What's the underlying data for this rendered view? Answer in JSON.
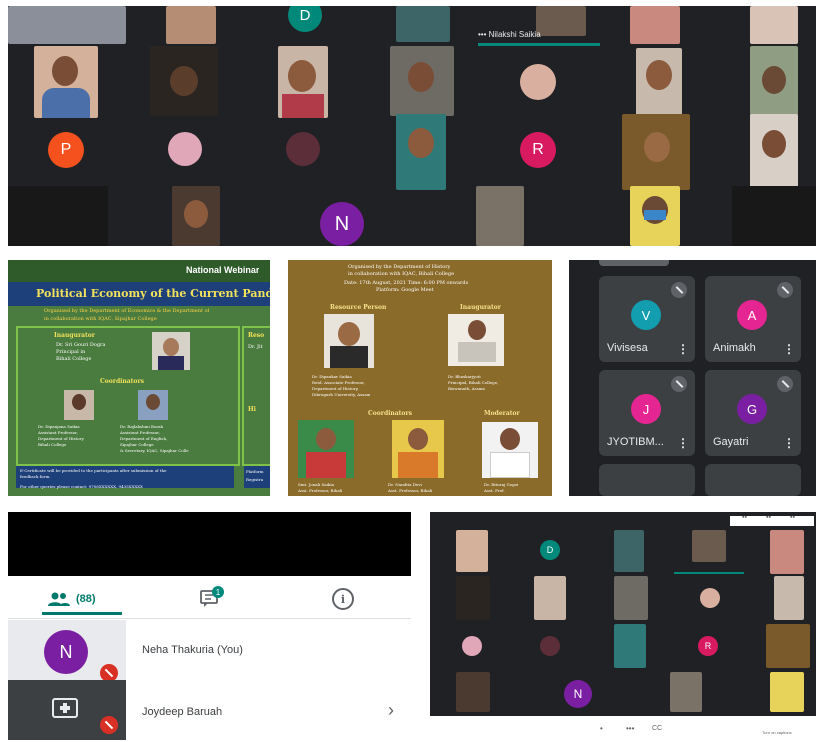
{
  "top_grid": {
    "tile_letters": [
      "D",
      "P",
      "R",
      "N"
    ],
    "name_strip": "••• Nilakshi Saikia"
  },
  "poster1": {
    "banner": "National Webinar",
    "title": "Political Economy of the Current Pandemic: C",
    "subtitle": "Organised by the Department of Economics & the Department of",
    "subtitle2": "in collaboration with IQAC, Sipajhar College",
    "inaugurator_heading": "Inaugurator",
    "inaugurator_name": "Dr. Sri Gouri Dogra",
    "inaugurator_role": "Principal in",
    "inaugurator_org": "Bihali College",
    "coordinators_heading": "Coordinators",
    "coord1_name": "Dr. Dipanjana Saikia",
    "coord1_role": "Assistant Professor,",
    "coord1_dept": "Department of History",
    "coord1_org": "Bihali College",
    "coord2_name": "Dr. Rajlakshmi Borah",
    "coord2_role": "Assistant Professor,",
    "coord2_dept": "Department of English,",
    "coord2_org": "Sipajhar College",
    "coord2_extra": "& Secretary, IQAC, Sipajhar Colle",
    "footer1": "E-Certificate will be provided to the participants after submission of the",
    "footer1b": "feedback form.",
    "footer2": "For other queries please contact: 9706XXXXXX, 9435XXXXX",
    "right_heading": "Reso",
    "right_name": "Dr. Jit",
    "right_label1": "Hi",
    "right_footer": "Platform",
    "right_footer2": "Registra"
  },
  "poster2": {
    "line1": "Organised by the Department of History",
    "line2": "in collaboration with IQAC, Bihali College",
    "line3": "Date: 17th August, 2021 Time: 6:00 PM onwards",
    "line4": "Platform: Google Meet",
    "resource_heading": "Resource Person",
    "inaugurator_heading": "Inaugurator",
    "resource_name": "Dr. Dipankar Saikia",
    "resource_role": "Retd. Associate Professor,",
    "resource_dept": "Department of History,",
    "resource_org": "Dibrugarh University, Assam",
    "inaug_name": "Dr. Bhaskarjyoti",
    "inaug_role": "Principal, Bihali College,",
    "inaug_org": "Biswanath, Assam",
    "coord_heading": "Coordinators",
    "moderator_heading": "Moderator",
    "c1_name": "Smt. Jonali Saikia",
    "c1_role": "Asst. Professor, Bihali",
    "c2_name": "Dr. Nandita Devi",
    "c2_role": "Asst. Professor, Bihali",
    "mod_name": "Dr. Rituraj Gogoi",
    "mod_role": "Asst. Prof."
  },
  "participant_grid": {
    "tiles": [
      {
        "letter": "V",
        "name": "Vivisesa",
        "color": "#129eaf"
      },
      {
        "letter": "A",
        "name": "Animakh",
        "color": "#e52592"
      },
      {
        "letter": "J",
        "name": "JYOTIBM...",
        "color": "#e52592"
      },
      {
        "letter": "G",
        "name": "Gayatri",
        "color": "#7b1fa2"
      }
    ],
    "kebab": "⋮"
  },
  "people_panel": {
    "tab_people_count": "(88)",
    "tab_chat_badge": "1",
    "info_icon": "i",
    "rows": [
      {
        "avatar_letter": "N",
        "name": "Neha Thakuria (You)"
      },
      {
        "avatar_letter": "",
        "name": "Joydeep Baruah"
      }
    ],
    "chevron": "›"
  },
  "bottom_grid": {
    "tile_letters": [
      "D",
      "R",
      "N"
    ],
    "controls": [
      "•",
      "•••",
      "CC"
    ],
    "corner_label": "Turn on captions"
  },
  "colors": {
    "meet_dark": "#202124",
    "tile_gray": "#3c4043",
    "accent_green": "#00897b",
    "avatar_purple": "#7b1fa2",
    "avatar_pink": "#e52592",
    "avatar_orange": "#f4511e",
    "poster_green": "#4a7c3f",
    "poster_gold": "#8b6b2a"
  }
}
